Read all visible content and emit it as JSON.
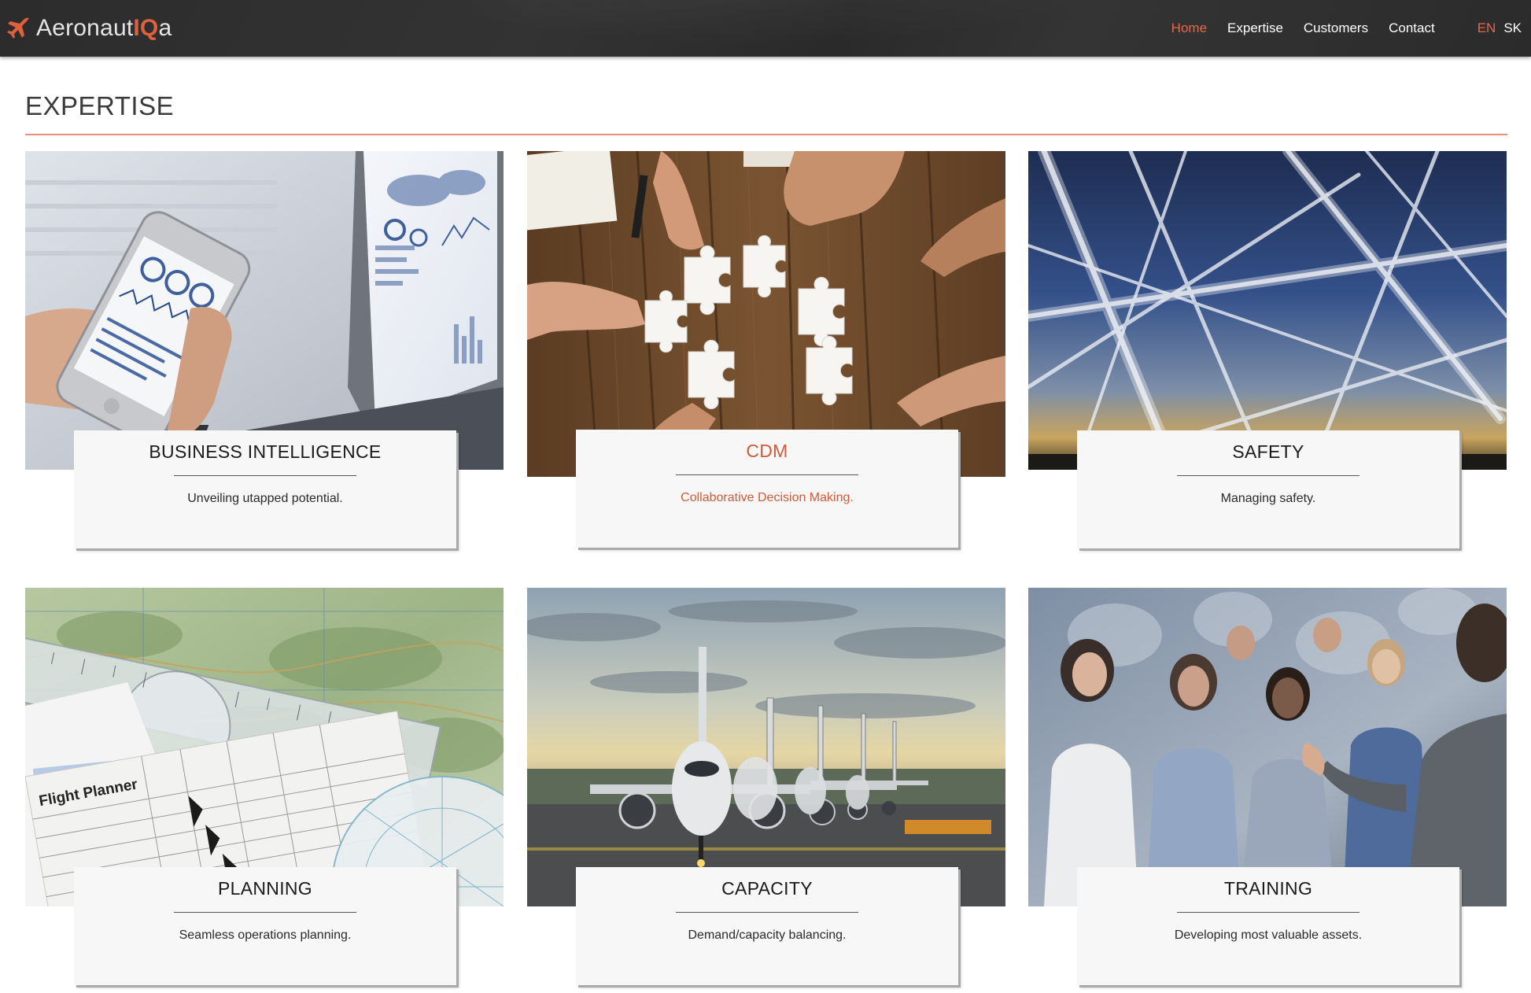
{
  "brand": {
    "name_prefix": "Aeronaut",
    "name_accent": "IQ",
    "name_suffix": "a",
    "accent_color": "#e0603c"
  },
  "nav": {
    "items": [
      {
        "label": "Home",
        "active": true
      },
      {
        "label": "Expertise",
        "active": false
      },
      {
        "label": "Customers",
        "active": false
      },
      {
        "label": "Contact",
        "active": false
      }
    ],
    "languages": [
      {
        "label": "EN",
        "active": true
      },
      {
        "label": "SK",
        "active": false
      }
    ]
  },
  "page": {
    "title": "EXPERTISE"
  },
  "cards": [
    {
      "title": "BUSINESS INTELLIGENCE",
      "subtitle": "Unveiling utapped potential.",
      "image": "analytics-devices-photo"
    },
    {
      "title": "CDM",
      "subtitle": "Collaborative Decision Making.",
      "image": "puzzle-teamwork-photo",
      "highlighted": true
    },
    {
      "title": "SAFETY",
      "subtitle": "Managing safety.",
      "image": "contrails-sky-photo"
    },
    {
      "title": "PLANNING",
      "subtitle": "Seamless operations planning.",
      "image": "flight-planner-map-photo",
      "image_text": "Flight Planner"
    },
    {
      "title": "CAPACITY",
      "subtitle": "Demand/capacity balancing.",
      "image": "airplanes-queue-photo"
    },
    {
      "title": "TRAINING",
      "subtitle": "Developing most valuable assets.",
      "image": "training-audience-photo"
    }
  ]
}
